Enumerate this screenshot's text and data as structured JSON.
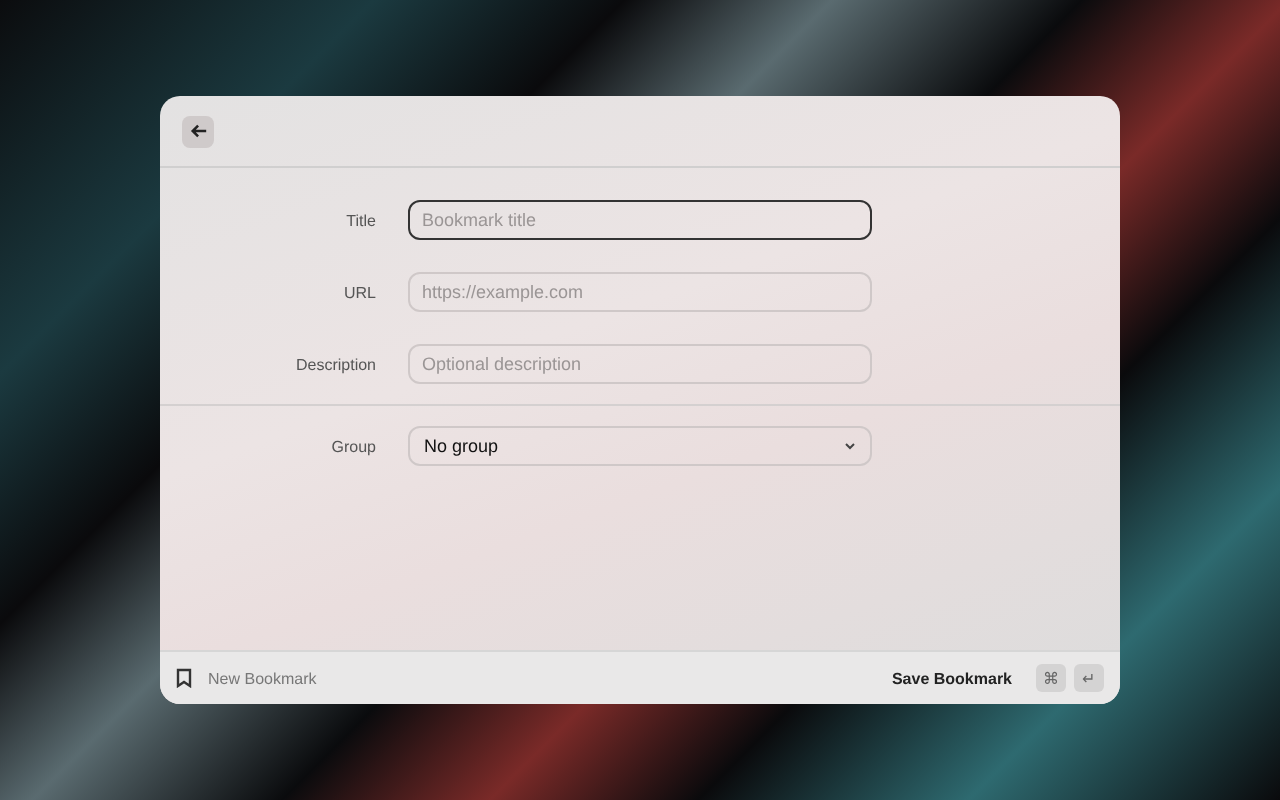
{
  "fields": [
    {
      "label": "Title",
      "placeholder": "Bookmark title",
      "focused": true
    },
    {
      "label": "URL",
      "placeholder": "https://example.com",
      "focused": false
    },
    {
      "label": "Description",
      "placeholder": "Optional description",
      "focused": false
    }
  ],
  "group": {
    "label": "Group",
    "value": "No group"
  },
  "footer": {
    "title": "New Bookmark",
    "action": "Save Bookmark",
    "keys": [
      "⌘",
      "↵"
    ]
  }
}
